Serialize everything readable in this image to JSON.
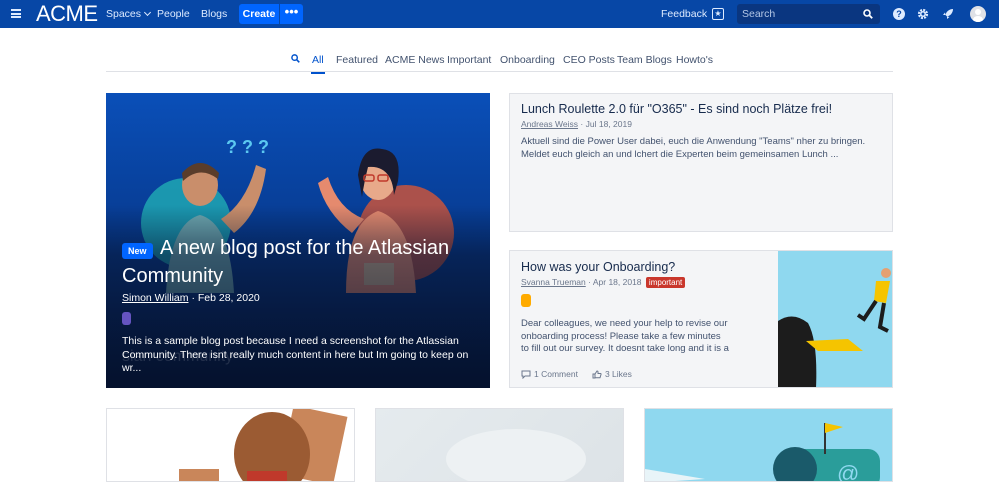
{
  "topnav": {
    "logo": "ACME",
    "spaces": "Spaces",
    "people": "People",
    "blogs": "Blogs",
    "create": "Create",
    "more": "•••",
    "feedback": "Feedback",
    "search_placeholder": "Search",
    "icons": [
      "hamburger-icon",
      "chevron-down-icon",
      "star-icon",
      "search-icon",
      "help-icon",
      "gear-icon",
      "rocket-icon",
      "avatar"
    ]
  },
  "tabs": [
    "All",
    "Featured",
    "ACME News",
    "Important",
    "Onboarding",
    "CEO Posts",
    "Team Blogs",
    "Howto's"
  ],
  "active_tab": "All",
  "hero": {
    "badge": "New",
    "title": "A new blog post for the Atlassian Community",
    "author": "Simon William",
    "separator": "·",
    "date": "Feb 28, 2020",
    "excerpt": "This is a sample blog post because I need a screenshot for the Atlassian Community. There isnt really much content in here but Im going to keep on wr...",
    "watermark": "sian community",
    "illustration_marks": "? ? ?"
  },
  "card1": {
    "title": "Lunch Roulette 2.0 für \"O365\" - Es sind noch Plätze frei!",
    "author": "Andreas Weiss",
    "separator": "·",
    "date": "Jul 18, 2019",
    "excerpt": "Aktuell sind die Power User dabei, euch die Anwendung \"Teams\" nher zu bringen. Meldet euch gleich an und lchert die Experten beim gemeinsamen Lunch ..."
  },
  "card2": {
    "title": "How was your Onboarding?",
    "author": "Svanna Trueman",
    "separator": "·",
    "date": "Apr 18, 2018",
    "label": "important",
    "excerpt": "Dear colleagues, we need your help to revise our onboarding process! Please take a few minutes to fill out our survey. It doesnt take long and it is a",
    "comments": "1 Comment",
    "likes": "3 Likes"
  },
  "colors": {
    "nav": "#0747a6",
    "accent": "#0065ff",
    "important": "#c9372c",
    "purple_tag": "#6554c0",
    "yellow_tag": "#ffab00"
  }
}
